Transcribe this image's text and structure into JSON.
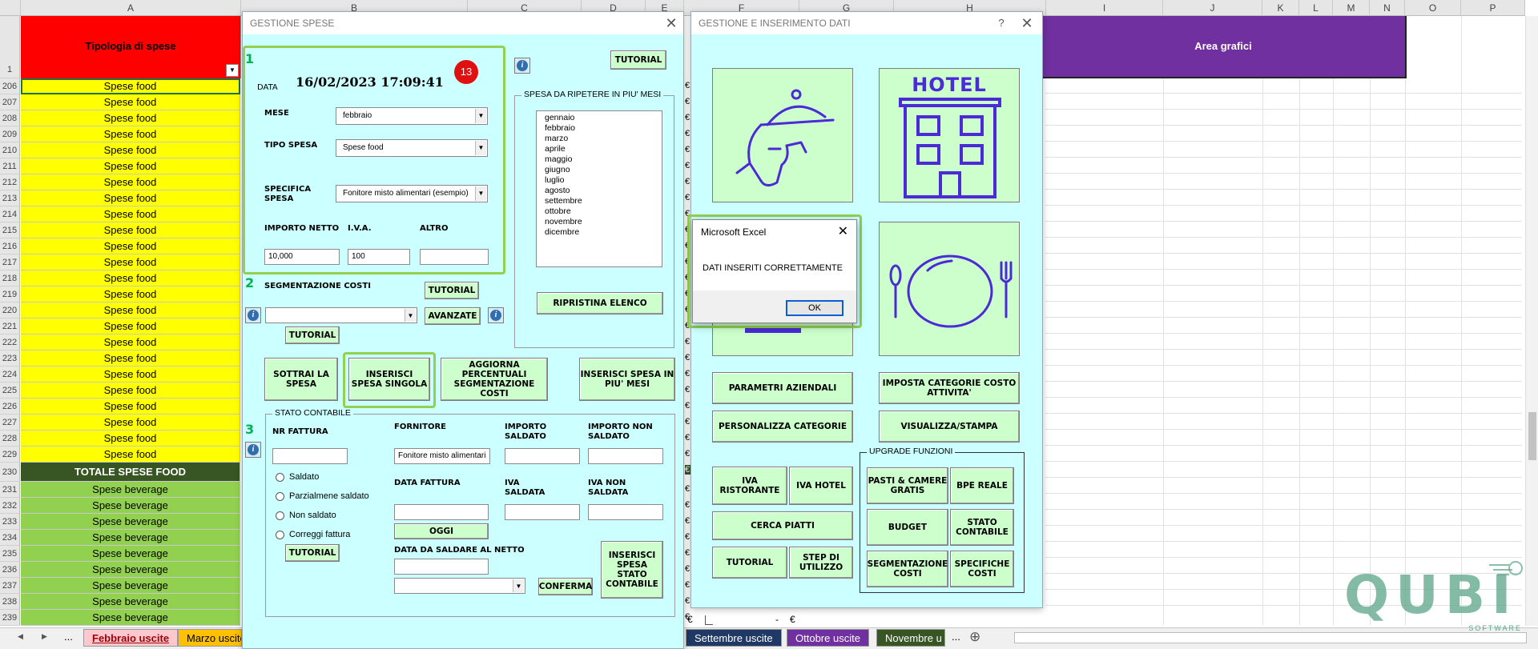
{
  "sheet": {
    "columns": [
      "A",
      "B",
      "C",
      "D",
      "E",
      "F",
      "G",
      "H",
      "I",
      "J",
      "K",
      "L",
      "M",
      "N",
      "O",
      "P"
    ],
    "header_cell_a": "Tipologia di spese",
    "header_area_grafici": "Area grafici",
    "row1_number": "1",
    "rows": [
      {
        "n": "206",
        "t": "Spese food"
      },
      {
        "n": "207",
        "t": "Spese food"
      },
      {
        "n": "208",
        "t": "Spese food"
      },
      {
        "n": "209",
        "t": "Spese food"
      },
      {
        "n": "210",
        "t": "Spese food"
      },
      {
        "n": "211",
        "t": "Spese food"
      },
      {
        "n": "212",
        "t": "Spese food"
      },
      {
        "n": "213",
        "t": "Spese food"
      },
      {
        "n": "214",
        "t": "Spese food"
      },
      {
        "n": "215",
        "t": "Spese food"
      },
      {
        "n": "216",
        "t": "Spese food"
      },
      {
        "n": "217",
        "t": "Spese food"
      },
      {
        "n": "218",
        "t": "Spese food"
      },
      {
        "n": "219",
        "t": "Spese food"
      },
      {
        "n": "220",
        "t": "Spese food"
      },
      {
        "n": "221",
        "t": "Spese food"
      },
      {
        "n": "222",
        "t": "Spese food"
      },
      {
        "n": "223",
        "t": "Spese food"
      },
      {
        "n": "224",
        "t": "Spese food"
      },
      {
        "n": "225",
        "t": "Spese food"
      },
      {
        "n": "226",
        "t": "Spese food"
      },
      {
        "n": "227",
        "t": "Spese food"
      },
      {
        "n": "228",
        "t": "Spese food"
      },
      {
        "n": "229",
        "t": "Spese food"
      },
      {
        "n": "230",
        "t": "TOTALE SPESE FOOD"
      },
      {
        "n": "231",
        "t": "Spese beverage"
      },
      {
        "n": "232",
        "t": "Spese beverage"
      },
      {
        "n": "233",
        "t": "Spese beverage"
      },
      {
        "n": "234",
        "t": "Spese beverage"
      },
      {
        "n": "235",
        "t": "Spese beverage"
      },
      {
        "n": "236",
        "t": "Spese beverage"
      },
      {
        "n": "237",
        "t": "Spese beverage"
      },
      {
        "n": "238",
        "t": "Spese beverage"
      },
      {
        "n": "239",
        "t": "Spese beverage"
      }
    ],
    "bottom_cell": "-",
    "euro_sign": "€",
    "tabs": {
      "nav_left": "◀",
      "nav_right": "▶",
      "ellipsis": "...",
      "febbraio": "Febbraio uscite",
      "marzo": "Marzo uscite",
      "settembre": "Settembre uscite",
      "ottobre": "Ottobre uscite",
      "novembre": "Novembre u",
      "add": "⊕"
    },
    "colors": {
      "yellow": "#ffff00",
      "red": "#ff0000",
      "green": "#92d050",
      "darkgreen": "#375623",
      "purple": "#7030a0"
    }
  },
  "gestione_spese": {
    "title": "GESTIONE SPESE",
    "close": "✕",
    "step1": "1",
    "step2": "2",
    "step3": "3",
    "badge": "13",
    "data_label": "DATA",
    "data_value": "16/02/2023 17:09:41",
    "mese_label": "MESE",
    "mese_value": "febbraio",
    "tipo_label": "TIPO SPESA",
    "tipo_value": "Spese food",
    "specifica_label": "SPECIFICA SPESA",
    "specifica_value": "Fonitore misto alimentari (esempio)",
    "importo_label": "IMPORTO NETTO",
    "importo_value": "10,000",
    "iva_label": "I.V.A.",
    "iva_value": "100",
    "altro_label": "ALTRO",
    "altro_value": "",
    "tutorial": "TUTORIAL",
    "ripetere_title": "SPESA DA RIPETERE IN PIU' MESI",
    "mesi": [
      "gennaio",
      "febbraio",
      "marzo",
      "aprile",
      "maggio",
      "giugno",
      "luglio",
      "agosto",
      "settembre",
      "ottobre",
      "novembre",
      "dicembre"
    ],
    "ripristina": "RIPRISTINA ELENCO",
    "segmentazione_label": "SEGMENTAZIONE COSTI",
    "avanzate": "AVANZATE",
    "sottrai": "SOTTRAI LA SPESA",
    "inserisci_singola": "INSERISCI SPESA SINGOLA",
    "aggiorna": "AGGIORNA PERCENTUALI SEGMENTAZIONE COSTI",
    "inserisci_piu": "INSERISCI SPESA IN PIU' MESI",
    "stato_title": "STATO CONTABILE",
    "nr_fattura": "NR FATTURA",
    "fornitore": "FORNITORE",
    "fornitore_value": "Fonitore misto alimentari",
    "importo_saldato": "IMPORTO SALDATO",
    "importo_non_saldato": "IMPORTO NON SALDATO",
    "radios": [
      "Saldato",
      "Parzialmene saldato",
      "Non saldato",
      "Correggi fattura"
    ],
    "data_fattura": "DATA FATTURA",
    "iva_saldata": "IVA SALDATA",
    "iva_non_saldata": "IVA NON SALDATA",
    "oggi": "OGGI",
    "data_da_saldare": "DATA DA SALDARE AL NETTO",
    "conferma": "CONFERMA",
    "inserisci_stato": "INSERISCI SPESA STATO CONTABILE",
    "info": "i"
  },
  "gestione_dati": {
    "title": "GESTIONE E INSERIMENTO DATI",
    "help": "?",
    "close": "✕",
    "hotel_text": "HOTEL",
    "parametri": "PARAMETRI AZIENDALI",
    "imposta": "IMPOSTA CATEGORIE COSTO ATTIVITA'",
    "personalizza": "PERSONALIZZA CATEGORIE",
    "visualizza": "VISUALIZZA/STAMPA",
    "upgrade_title": "UPGRADE FUNZIONI",
    "iva_ristorante": "IVA RISTORANTE",
    "iva_hotel": "IVA HOTEL",
    "cerca_piatti": "CERCA PIATTI",
    "tutorial": "TUTORIAL",
    "step_utilizzo": "STEP DI UTILIZZO",
    "pasti_camere": "PASTI & CAMERE GRATIS",
    "bpe_reale": "BPE REALE",
    "budget": "BUDGET",
    "stato_contabile": "STATO CONTABILE",
    "segmentazione": "SEGMENTAZIONE COSTI",
    "specifiche": "SPECIFICHE COSTI"
  },
  "msgbox": {
    "title": "Microsoft Excel",
    "close": "✕",
    "message": "DATI INSERITI CORRETTAMENTE",
    "ok": "OK"
  },
  "watermark": {
    "text": "QUBI",
    "sub": "SOFTWARE"
  }
}
